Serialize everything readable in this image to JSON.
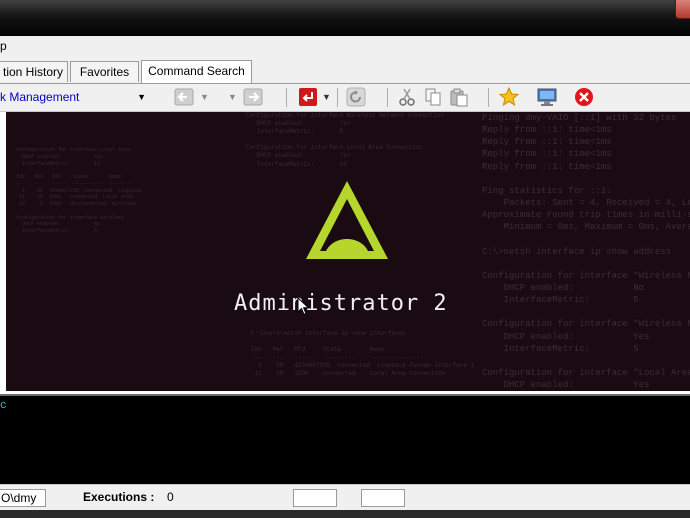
{
  "menubar": {
    "item": "p"
  },
  "tabs": [
    {
      "label": "tion History"
    },
    {
      "label": "Favorites"
    },
    {
      "label": "Command Search"
    }
  ],
  "toolbar": {
    "combo_value": "k Management",
    "icons": [
      "back-icon",
      "forward-icon",
      "enter-icon",
      "refresh-icon",
      "cut-icon",
      "copy-icon",
      "paste-icon",
      "star-icon",
      "monitor-icon",
      "close-icon"
    ]
  },
  "splash": {
    "title": "Administrator 2"
  },
  "console": {
    "prompt": "c"
  },
  "statusbar": {
    "path": "O\\dmy",
    "executions_label": "Executions :",
    "executions_value": "0"
  },
  "colors": {
    "accent_green": "#b6d62d",
    "browser_bg": "#1a0a12",
    "console_prompt": "#27c6c6",
    "combo_text": "#0000cc"
  }
}
